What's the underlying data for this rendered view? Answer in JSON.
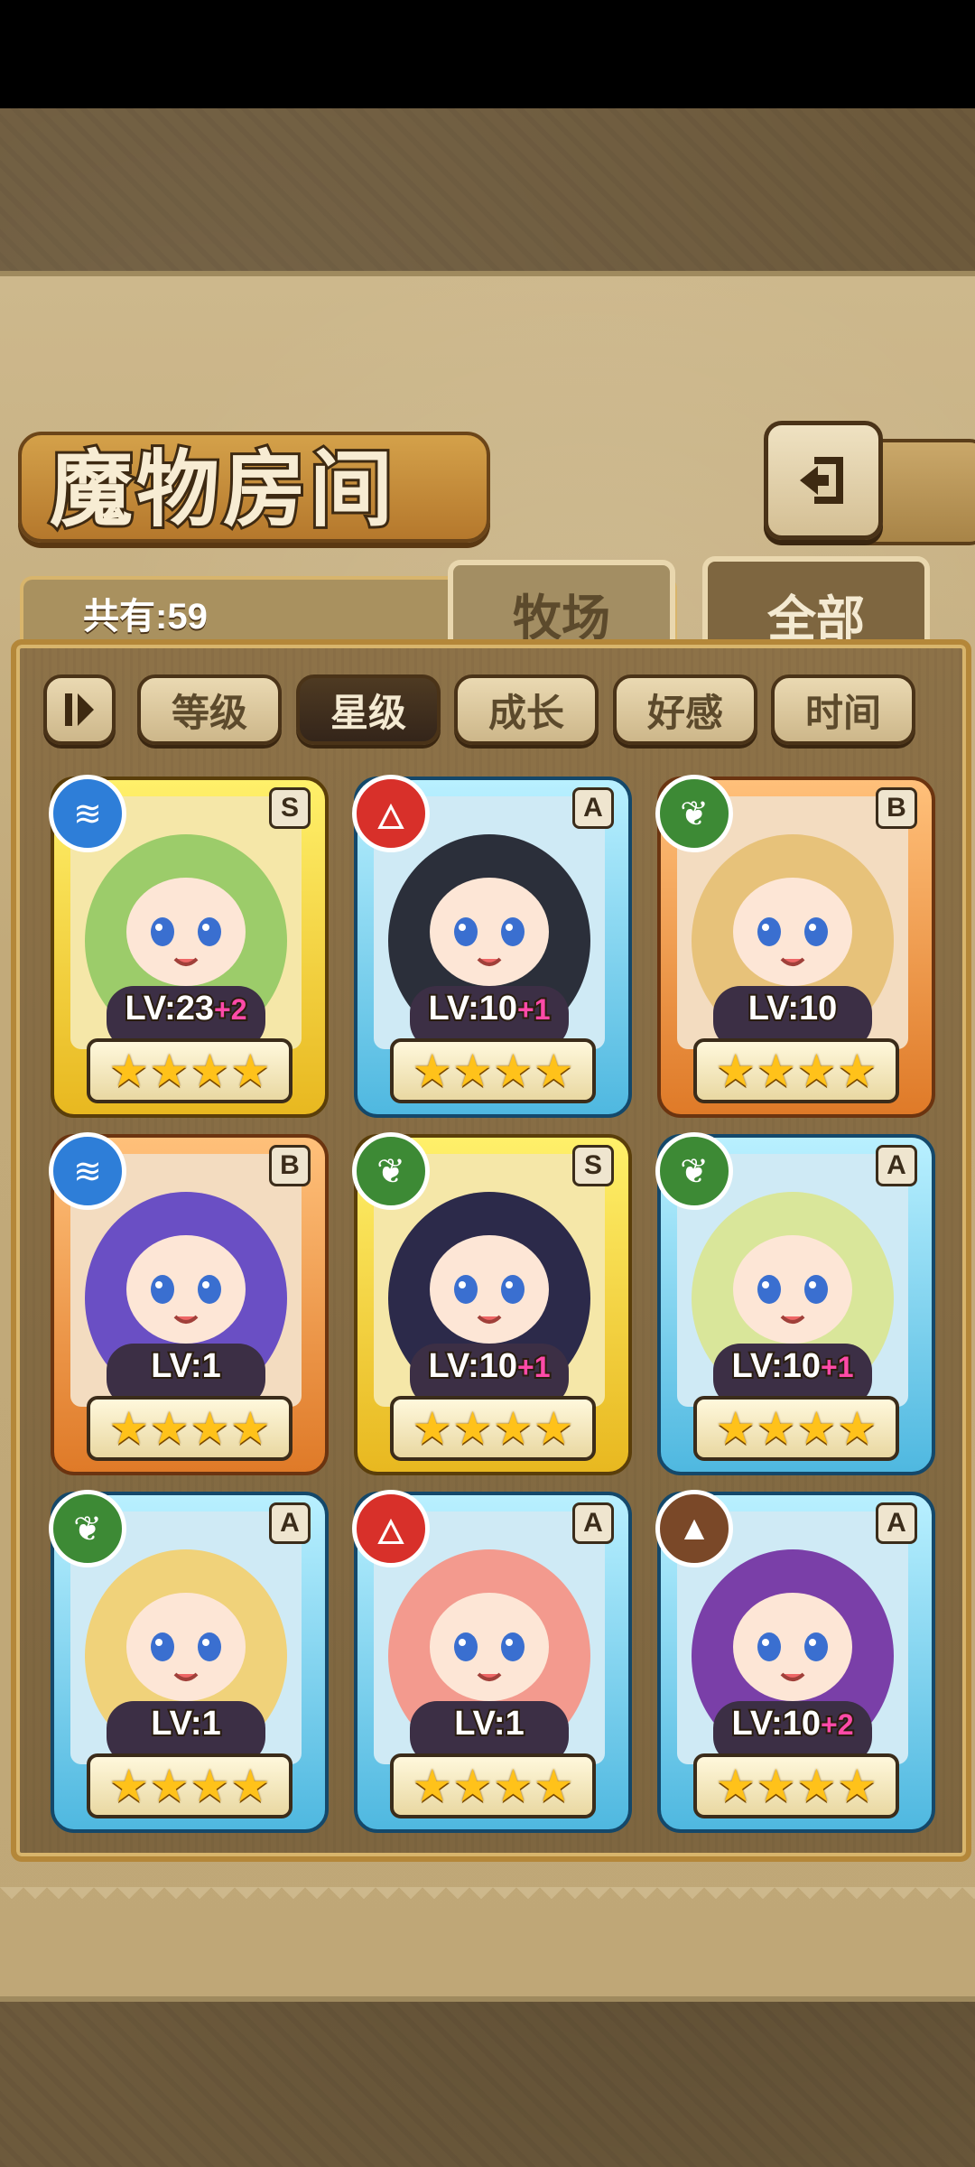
{
  "header": {
    "title": "魔物房间",
    "back_icon": "return-arrow-icon"
  },
  "tabs": {
    "count_label": "共有:59",
    "farm": "牧场",
    "all": "全部"
  },
  "sort": {
    "toggle_icon": "sort-order-icon",
    "buttons": [
      "等级",
      "星级",
      "成长",
      "好感",
      "时间"
    ],
    "active": "星级"
  },
  "monsters": [
    {
      "rank": "S",
      "element": "water",
      "level": "LV:23",
      "plus": "+2",
      "stars": "★★★★",
      "frame": "gold",
      "hair": "#9ccc6a"
    },
    {
      "rank": "A",
      "element": "fire",
      "level": "LV:10",
      "plus": "+1",
      "stars": "★★★★",
      "frame": "blue",
      "hair": "#2b2f3a"
    },
    {
      "rank": "B",
      "element": "leaf",
      "level": "LV:10",
      "plus": "",
      "stars": "★★★★",
      "frame": "orange",
      "hair": "#e7c27a"
    },
    {
      "rank": "B",
      "element": "water",
      "level": "LV:1",
      "plus": "",
      "stars": "★★★★",
      "frame": "orange",
      "hair": "#6a4fc4"
    },
    {
      "rank": "S",
      "element": "leaf",
      "level": "LV:10",
      "plus": "+1",
      "stars": "★★★★",
      "frame": "gold",
      "hair": "#2c2a4a"
    },
    {
      "rank": "A",
      "element": "leaf",
      "level": "LV:10",
      "plus": "+1",
      "stars": "★★★★",
      "frame": "blue",
      "hair": "#d9e69a"
    },
    {
      "rank": "A",
      "element": "leaf",
      "level": "LV:1",
      "plus": "",
      "stars": "★★★★",
      "frame": "blue",
      "hair": "#f0d27a"
    },
    {
      "rank": "A",
      "element": "fire",
      "level": "LV:1",
      "plus": "",
      "stars": "★★★★",
      "frame": "blue",
      "hair": "#f39a8e"
    },
    {
      "rank": "A",
      "element": "earth",
      "level": "LV:10",
      "plus": "+2",
      "stars": "★★★★",
      "frame": "blue",
      "hair": "#7a3fa8"
    }
  ]
}
